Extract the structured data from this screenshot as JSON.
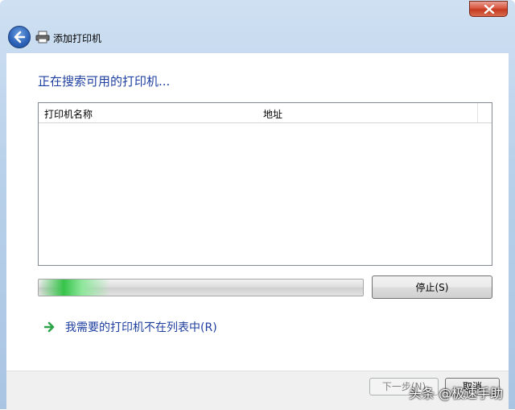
{
  "window": {
    "title": "添加打印机"
  },
  "main": {
    "heading": "正在搜索可用的打印机..."
  },
  "list": {
    "columns": [
      "打印机名称",
      "地址"
    ]
  },
  "progress": {
    "value_fraction": 0.22,
    "color": "#37c34a"
  },
  "buttons": {
    "stop": "停止(S)",
    "next": "下一步(N)",
    "cancel": "取消"
  },
  "link": {
    "not_listed": "我需要的打印机不在列表中(R)"
  },
  "watermark": "头条 @极速手助",
  "colors": {
    "accent_text": "#1e3fa0",
    "close_red": "#c43b1f",
    "back_blue": "#2b62b8"
  },
  "icons": [
    "close-icon",
    "back-arrow-icon",
    "printer-icon",
    "green-arrow-icon"
  ]
}
